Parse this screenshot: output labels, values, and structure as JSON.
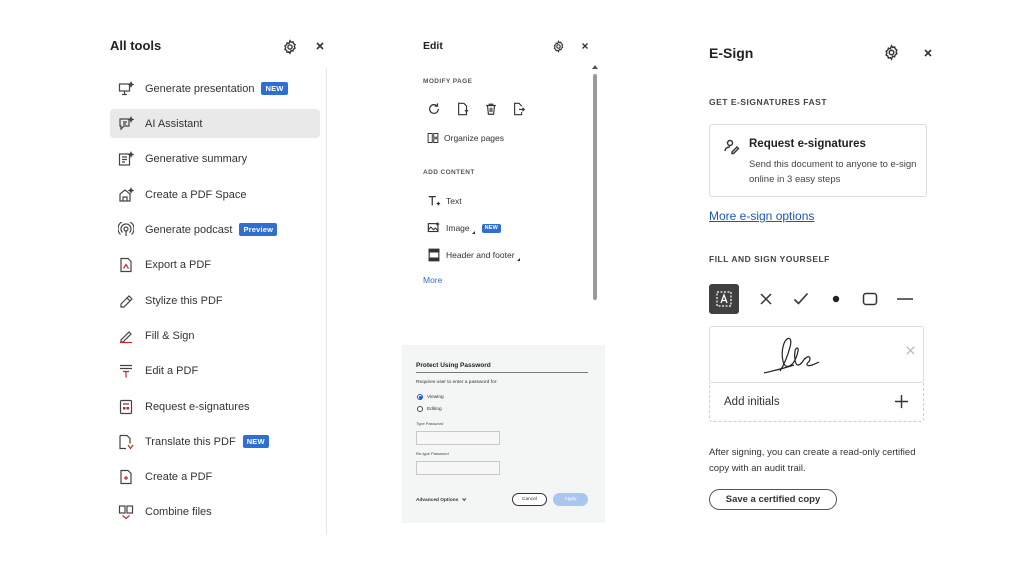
{
  "all_tools": {
    "title": "All tools",
    "items": [
      {
        "label": "Generate presentation",
        "badge": "NEW",
        "icon": "presentation-sparkle-icon"
      },
      {
        "label": "AI Assistant",
        "badge": "",
        "icon": "ai-assistant-icon",
        "active": true
      },
      {
        "label": "Generative summary",
        "badge": "",
        "icon": "summary-sparkle-icon"
      },
      {
        "label": "Create a PDF Space",
        "badge": "",
        "icon": "pdf-space-icon"
      },
      {
        "label": "Generate podcast",
        "badge": "Preview",
        "icon": "podcast-icon"
      },
      {
        "label": "Export a PDF",
        "badge": "",
        "icon": "export-pdf-icon"
      },
      {
        "label": "Stylize this PDF",
        "badge": "",
        "icon": "stylize-icon"
      },
      {
        "label": "Fill & Sign",
        "badge": "",
        "icon": "fill-sign-icon"
      },
      {
        "label": "Edit a PDF",
        "badge": "",
        "icon": "edit-pdf-icon"
      },
      {
        "label": "Request e-signatures",
        "badge": "",
        "icon": "request-esign-icon"
      },
      {
        "label": "Translate this PDF",
        "badge": "NEW",
        "icon": "translate-icon"
      },
      {
        "label": "Create a PDF",
        "badge": "",
        "icon": "create-pdf-icon"
      },
      {
        "label": "Combine files",
        "badge": "",
        "icon": "combine-files-icon"
      }
    ]
  },
  "edit": {
    "title": "Edit",
    "modify_heading": "MODIFY PAGE",
    "organize_label": "Organize pages",
    "add_heading": "ADD CONTENT",
    "text_label": "Text",
    "image_label": "Image",
    "image_badge": "NEW",
    "header_footer_label": "Header and footer",
    "more_label": "More"
  },
  "protect": {
    "title": "Protect Using Password",
    "requires_text": "Requires user to enter a password for:",
    "option_viewing": "Viewing",
    "option_editing": "Editing",
    "selected": "Viewing",
    "type_password_label": "Type Password",
    "retype_password_label": "Re-type Password",
    "type_password_value": "",
    "retype_password_value": "",
    "advanced_label": "Advanced Options",
    "cancel_label": "Cancel",
    "apply_label": "Apply"
  },
  "esign": {
    "title": "E-Sign",
    "get_heading": "GET E-SIGNATURES FAST",
    "card_title": "Request e-signatures",
    "card_desc": "Send this document to anyone to e-sign online in 3 easy steps",
    "more_link": "More e-sign options",
    "fill_heading": "FILL AND SIGN YOURSELF",
    "tools": [
      "text-field-icon",
      "cross-mark-icon",
      "check-mark-icon",
      "dot-icon",
      "rectangle-icon",
      "line-icon"
    ],
    "initials_label": "Add initials",
    "after_text": "After signing, you can create a read-only certified copy with an audit trail.",
    "save_button": "Save a certified copy"
  },
  "colors": {
    "accent_blue": "#1e56b8",
    "badge_blue": "#2f6fd1",
    "active_item_bg": "#e9e9e9",
    "apply_disabled": "#a9c6f0"
  }
}
